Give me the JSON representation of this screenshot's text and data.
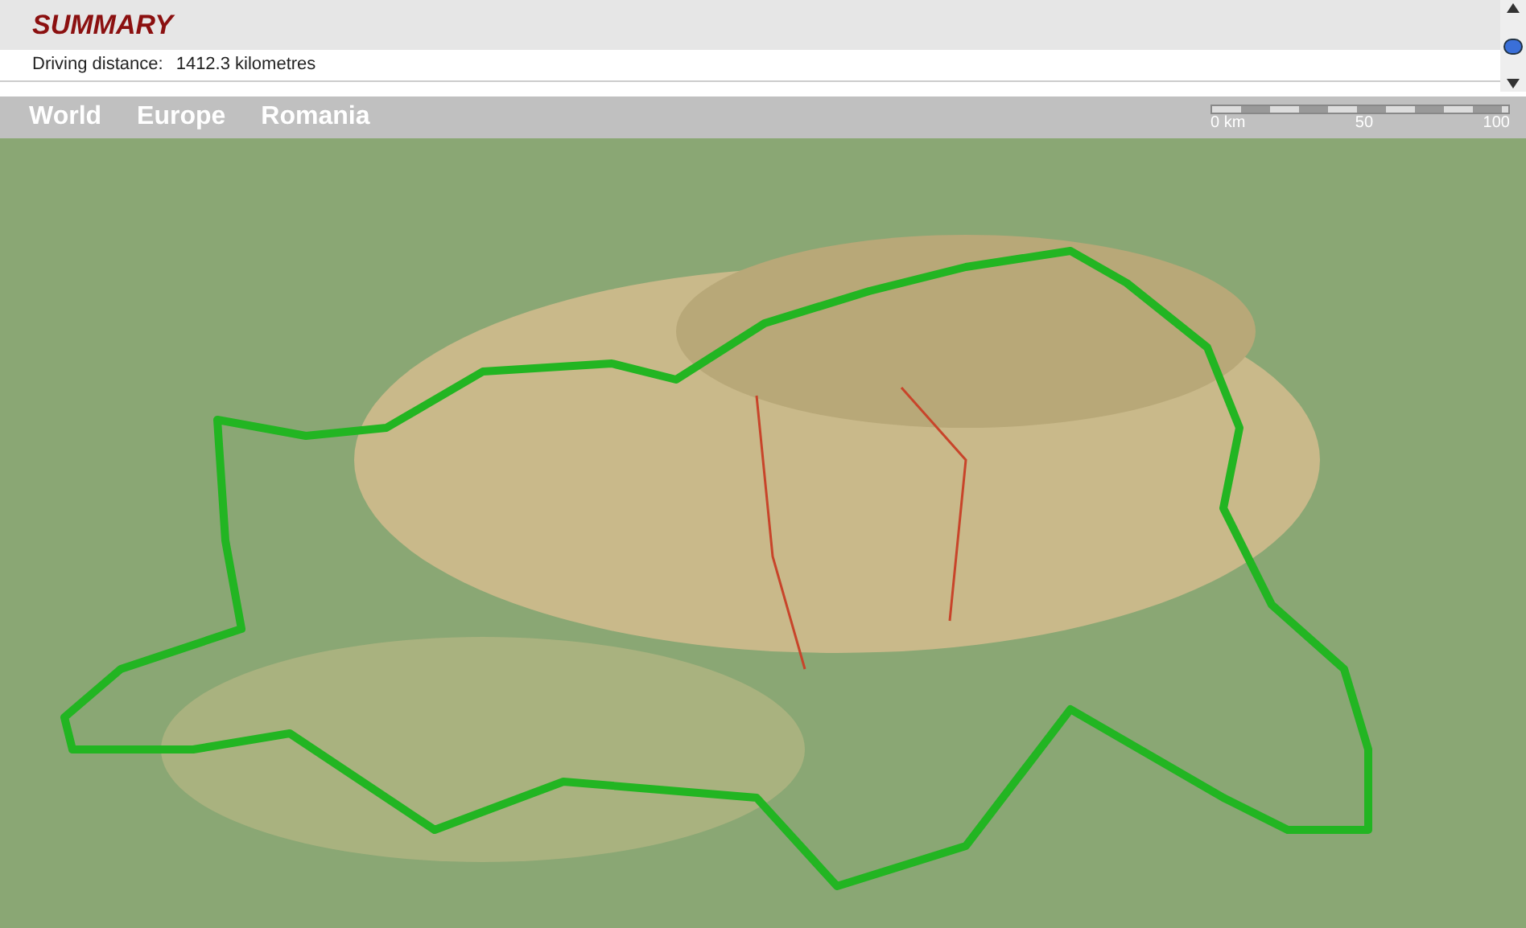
{
  "summary": {
    "title": "SUMMARY",
    "distance_label": "Driving distance:",
    "distance_value": "1412.3 kilometres"
  },
  "breadcrumb": [
    {
      "label": "World"
    },
    {
      "label": "Europe"
    },
    {
      "label": "Romania"
    }
  ],
  "scale": {
    "labels": [
      "0 km",
      "50",
      "100"
    ]
  }
}
